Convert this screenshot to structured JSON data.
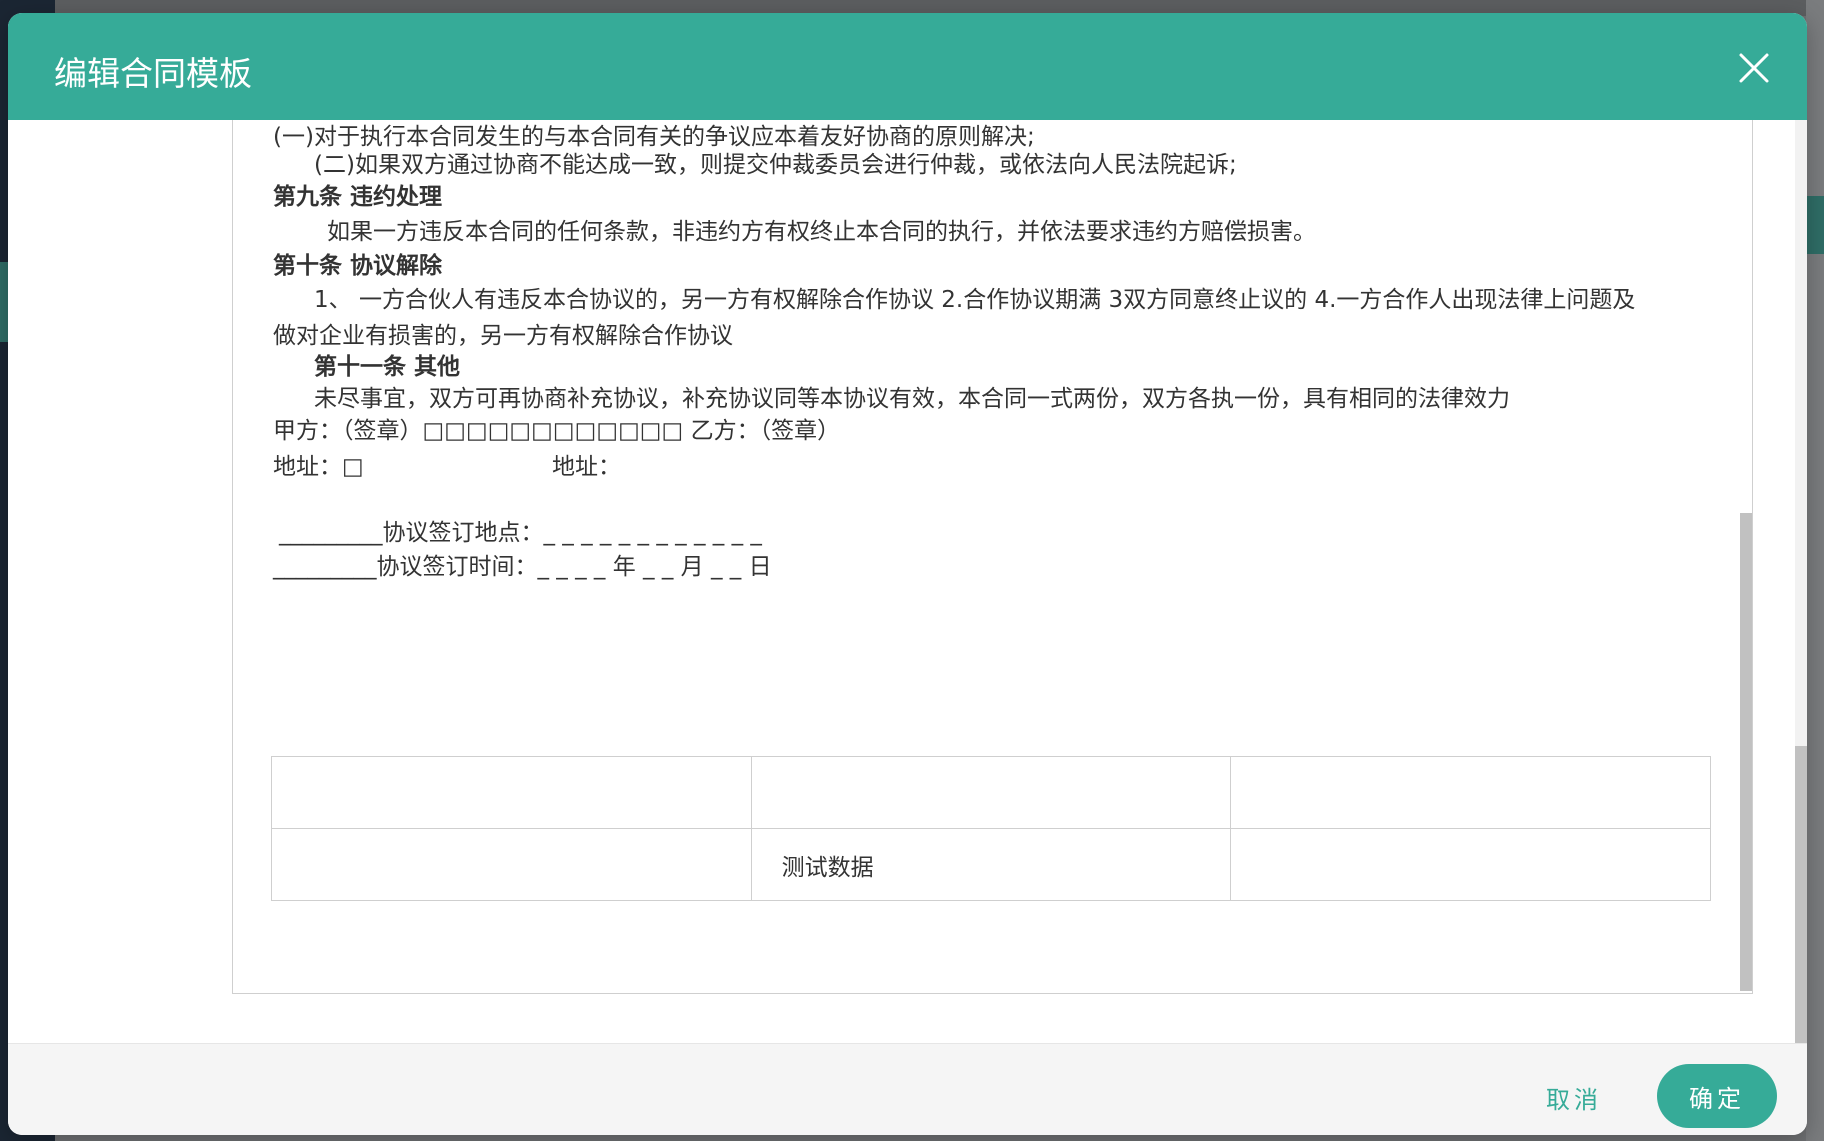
{
  "dialog": {
    "title": "编辑合同模板"
  },
  "contract": {
    "lines": [
      "(一)对于执行本合同发生的与本合同有关的争议应本着友好协商的原则解决;",
      "(二)如果双方通过协商不能达成一致，则提交仲裁委员会进行仲裁，或依法向人民法院起诉;",
      "第九条 违约处理",
      "如果一方违反本合同的任何条款，非违约方有权终止本合同的执行，并依法要求违约方赔偿损害。",
      "第十条 协议解除",
      "1、 一方合伙人有违反本合协议的，另一方有权解除合作协议 2.合作协议期满 3双方同意终止议的 4.一方合作人出现法律上问题及",
      "做对企业有损害的，另一方有权解除合作协议",
      "第十一条 其他",
      "未尽事宜，双方可再协商补充协议，补充协议同等本协议有效，本合同一式两份，双方各执一份，具有相同的法律效力",
      "甲方：（签章）□□□□□□□□□□□□ 乙方：（签章）",
      "地址：□",
      "地址：",
      "_________协议签订地点：_ _ _ _ _ _ _ _ _ _ _ _",
      "_________协议签订时间：_ _ _ _ 年 _ _ 月 _ _ 日"
    ],
    "table": {
      "rows": [
        [
          "",
          "",
          ""
        ],
        [
          "",
          "测试数据",
          ""
        ]
      ]
    }
  },
  "footer": {
    "cancel_label": "取消",
    "ok_label": "确定"
  },
  "colors": {
    "accent": "#36ab98",
    "overlay": "#6f7173"
  },
  "icons": {
    "close": "close-icon"
  }
}
